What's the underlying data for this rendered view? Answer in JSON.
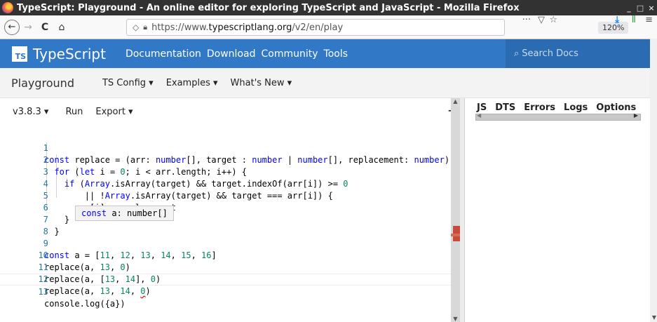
{
  "window": {
    "title": "TypeScript: Playground - An online editor for exploring TypeScript and JavaScript - Mozilla Firefox",
    "controls": [
      "_",
      "□",
      "×"
    ]
  },
  "browser": {
    "back": "←",
    "forward": "→",
    "reload": "C",
    "home": "⌂",
    "url_prefix": "https://www.",
    "url_domain": "typescriptlang.org",
    "url_path": "/v2/en/play",
    "zoom": "120%",
    "more": "···",
    "pocket": "▽",
    "bookmark": "☆",
    "download": "⤓",
    "library": "Ⅱ",
    "menu": "≡"
  },
  "site_header": {
    "logo": "TS",
    "brand": "TypeScript",
    "nav": [
      "Documentation",
      "Download",
      "Community",
      "Tools"
    ],
    "search_placeholder": "Search Docs"
  },
  "playground_bar": {
    "title": "Playground",
    "menus": [
      "TS Config ▾",
      "Examples ▾",
      "What's New ▾"
    ]
  },
  "editor_toolbar": {
    "version": "v3.8.3 ▾",
    "run": "Run",
    "export": "Export ▾",
    "tab_icon": "⇥"
  },
  "editor": {
    "lines": [
      {
        "n": "1",
        "code": "const replace = (arr: number[], target : number | number[], replacement: number) ="
      },
      {
        "n": "2",
        "code": "  for (let i = 0; i < arr.length; i++) {"
      },
      {
        "n": "3",
        "code": "    if (Array.isArray(target) && target.indexOf(arr[i]) >= 0"
      },
      {
        "n": "4",
        "code": "        || !Array.isArray(target) && target === arr[i]) {"
      },
      {
        "n": "5",
        "code": "      arr[i] = replacement"
      },
      {
        "n": "6",
        "code": "    }"
      },
      {
        "n": "7",
        "code": "  }"
      },
      {
        "n": "8",
        "code": ""
      },
      {
        "n": "9",
        "code": "const a = [11, 12, 13, 14, 15, 16]"
      },
      {
        "n": "10",
        "code": "replace(a, 13, 0)"
      },
      {
        "n": "11",
        "code": "replace(a, [13, 14], 0)"
      },
      {
        "n": "12",
        "code": "replace(a, 13, 14, 0)"
      },
      {
        "n": "13",
        "code": "console.log({a})"
      }
    ],
    "hover_tooltip": {
      "kw": "const",
      "name": " a: ",
      "type": "number[]"
    }
  },
  "sidebar": {
    "tabs": [
      "JS",
      "DTS",
      "Errors",
      "Logs",
      "Options"
    ],
    "active_tab": "Logs"
  }
}
